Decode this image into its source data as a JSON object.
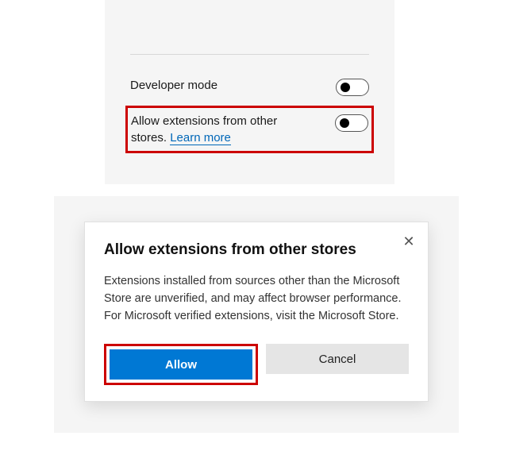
{
  "settings": {
    "developer_mode": {
      "label": "Developer mode",
      "enabled": false
    },
    "allow_other_stores": {
      "label_prefix": "Allow extensions from other stores. ",
      "learn_more": "Learn more",
      "enabled": false
    }
  },
  "dialog": {
    "title": "Allow extensions from other stores",
    "body": "Extensions installed from sources other than the Microsoft Store are unverified, and may affect browser performance. For Microsoft verified extensions, visit the Microsoft Store.",
    "primary": "Allow",
    "secondary": "Cancel"
  }
}
